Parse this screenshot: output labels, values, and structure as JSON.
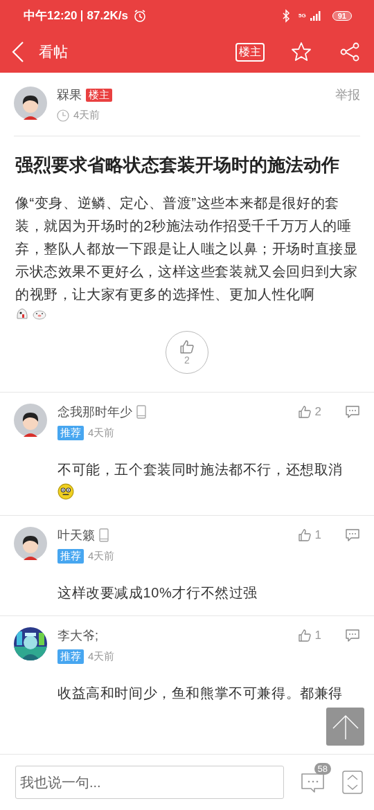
{
  "status_bar": {
    "time": "中午12:20",
    "speed": "87.2K/s",
    "network": "5G",
    "battery": "91"
  },
  "toolbar": {
    "title": "看帖",
    "owner_filter": "楼主"
  },
  "post": {
    "author": "槑果",
    "author_badge": "楼主",
    "time": "4天前",
    "report": "举报",
    "title": "强烈要求省略状态套装开场时的施法动作",
    "body": "像“变身、逆鳞、定心、普渡”这些本来都是很好的套装，就因为开场时的2秒施法动作招受千千万万人的唾弃，整队人都放一下跟是让人嗤之以鼻；开场时直接显示状态效果不更好么，这样这些套装就又会回归到大家的视野，让大家有更多的选择性、更加人性化啊",
    "emojis": [
      {
        "kind": "ghost"
      },
      {
        "kind": "pig"
      }
    ],
    "likes": "2"
  },
  "comments": [
    {
      "author": "念我那时年少",
      "phone": true,
      "photo_avatar": false,
      "tag": "推荐",
      "time": "4天前",
      "likes": "2",
      "text": "不可能，五个套装同时施法都不行，还想取消",
      "emojis": [
        {
          "kind": "face"
        }
      ]
    },
    {
      "author": "叶天籁",
      "phone": true,
      "photo_avatar": false,
      "tag": "推荐",
      "time": "4天前",
      "likes": "1",
      "text": "这样改要减成10%才行不然过强"
    },
    {
      "author": "李大爷;",
      "phone": false,
      "photo_avatar": true,
      "tag": "推荐",
      "time": "4天前",
      "likes": "1",
      "text": "收益高和时间少，鱼和熊掌不可兼得。都兼得"
    }
  ],
  "bottom_bar": {
    "placeholder": "我也说一句...",
    "comment_count": "58"
  }
}
